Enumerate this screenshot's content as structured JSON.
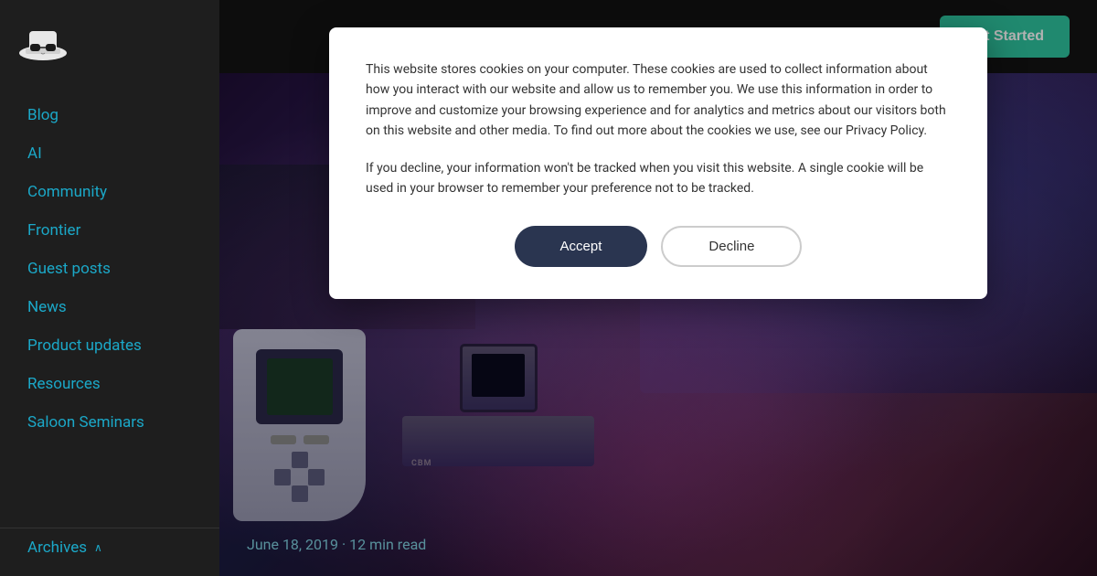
{
  "sidebar": {
    "logo_alt": "Code Sheriff logo",
    "nav_items": [
      {
        "label": "Blog",
        "id": "blog"
      },
      {
        "label": "AI",
        "id": "ai"
      },
      {
        "label": "Community",
        "id": "community"
      },
      {
        "label": "Frontier",
        "id": "frontier"
      },
      {
        "label": "Guest posts",
        "id": "guest-posts"
      },
      {
        "label": "News",
        "id": "news"
      },
      {
        "label": "Product updates",
        "id": "product-updates"
      },
      {
        "label": "Resources",
        "id": "resources"
      },
      {
        "label": "Saloon Seminars",
        "id": "saloon-seminars"
      }
    ],
    "archives_label": "Archives",
    "archives_chevron": "^"
  },
  "topbar": {
    "get_started_label": "Get Started"
  },
  "cookie": {
    "text_main": "This website stores cookies on your computer. These cookies are used to collect information about how you interact with our website and allow us to remember you. We use this information in order to improve and customize your browsing experience and for analytics and metrics about our visitors both on this website and other media. To find out more about the cookies we use, see our Privacy Policy.",
    "text_secondary": "If you decline, your information won't be tracked when you visit this website. A single cookie will be used in your browser to remember your preference not to be tracked.",
    "accept_label": "Accept",
    "decline_label": "Decline"
  },
  "hero": {
    "post_date": "June 18, 2019 · 12 min read"
  }
}
